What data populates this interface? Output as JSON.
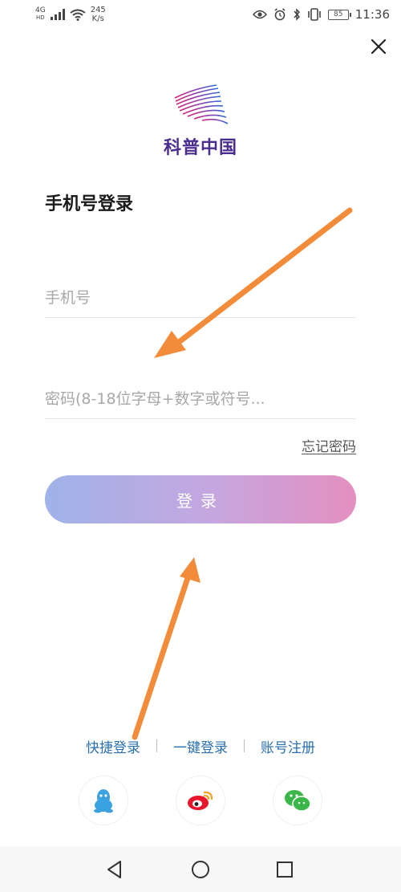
{
  "status_bar": {
    "network": "4G",
    "network_sub": "HD",
    "speed_value": "245",
    "speed_unit": "K/s",
    "battery": "85",
    "time": "11:36"
  },
  "logo": {
    "text": "科普中国"
  },
  "login": {
    "title": "手机号登录",
    "phone_placeholder": "手机号",
    "password_placeholder": "密码(8-18位字母+数字或符号...",
    "forgot_label": "忘记密码",
    "submit_label": "登录"
  },
  "alt_links": {
    "quick_login": "快捷登录",
    "one_click_login": "一键登录",
    "register": "账号注册"
  },
  "social": {
    "icons": [
      "qq-icon",
      "weibo-icon",
      "wechat-icon"
    ]
  },
  "colors": {
    "button_start": "#9fb3ea",
    "button_end": "#e48fc0",
    "link": "#2a6fae",
    "arrow": "#f28c3a",
    "brand_text": "#4a2d8f"
  }
}
